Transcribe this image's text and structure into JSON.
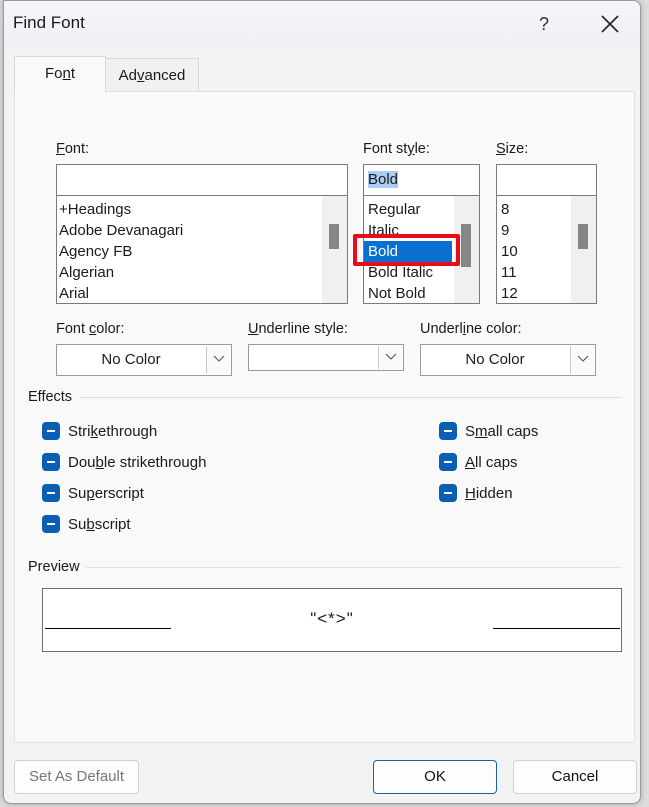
{
  "window": {
    "title": "Find Font",
    "help_label": "?",
    "close_icon": "close-icon"
  },
  "tabs": [
    {
      "label_pre": "Fo",
      "label_u": "n",
      "label_post": "t",
      "active": true
    },
    {
      "label_pre": "Ad",
      "label_u": "v",
      "label_post": "anced",
      "active": false
    }
  ],
  "font": {
    "label_u": "F",
    "label_post": "ont:",
    "value": "",
    "items": [
      "+Headings",
      "Adobe Devanagari",
      "Agency FB",
      "Algerian",
      "Arial"
    ]
  },
  "font_style": {
    "label_pre": "Font st",
    "label_u": "y",
    "label_post": "le:",
    "value": "Bold",
    "items": [
      "Regular",
      "Italic",
      "Bold",
      "Bold Italic",
      "Not Bold"
    ],
    "selected": "Bold"
  },
  "size": {
    "label_u": "S",
    "label_post": "ize:",
    "value": "",
    "items": [
      "8",
      "9",
      "10",
      "11",
      "12"
    ]
  },
  "font_color": {
    "label_pre": "Font ",
    "label_u": "c",
    "label_post": "olor:",
    "value": "No Color"
  },
  "underline_style": {
    "label_u": "U",
    "label_post": "nderline style:",
    "value": ""
  },
  "underline_color": {
    "label_pre": "Underl",
    "label_u": "i",
    "label_post": "ne color:",
    "value": "No Color"
  },
  "effects": {
    "title": "Effects",
    "left": [
      {
        "pre": "Stri",
        "u": "k",
        "post": "ethrough",
        "state": "indeterminate"
      },
      {
        "pre": "Dou",
        "u": "b",
        "post": "le strikethrough",
        "state": "indeterminate"
      },
      {
        "pre": "Su",
        "u": "p",
        "post": "erscript",
        "state": "indeterminate"
      },
      {
        "pre": "Su",
        "u": "b",
        "post": "script",
        "state": "indeterminate"
      }
    ],
    "right": [
      {
        "pre": "S",
        "u": "m",
        "post": "all caps",
        "state": "indeterminate"
      },
      {
        "pre": "",
        "u": "A",
        "post": "ll caps",
        "state": "indeterminate"
      },
      {
        "pre": "",
        "u": "H",
        "post": "idden",
        "state": "indeterminate"
      }
    ]
  },
  "preview": {
    "title": "Preview",
    "sample": "\"<*>\""
  },
  "buttons": {
    "set_default": "Set As Default",
    "ok": "OK",
    "cancel": "Cancel"
  },
  "colors": {
    "accent": "#0a6fd3",
    "checkbox": "#0a5fb4",
    "annotation": "#e50d17"
  }
}
